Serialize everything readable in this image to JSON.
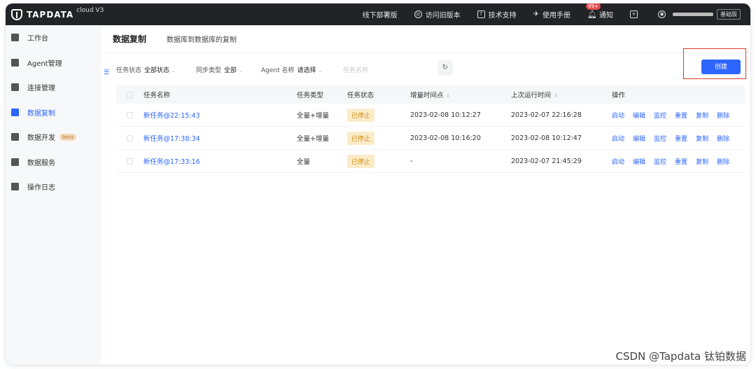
{
  "brand": {
    "logo_text": "TAPDATA",
    "logo_sub": "cloud V3"
  },
  "topbar": {
    "links": [
      {
        "icon": "",
        "label": "线下部署版"
      },
      {
        "icon": "globe-icon",
        "label": "访问旧版本"
      },
      {
        "icon": "help-icon",
        "label": "技术支持"
      },
      {
        "icon": "send-icon",
        "label": "使用手册"
      }
    ],
    "notification_badge": "99+",
    "notification_label": "通知",
    "edition": "基础版"
  },
  "sidebar": {
    "items": [
      {
        "icon": "dashboard-icon",
        "label": "工作台",
        "active": false
      },
      {
        "icon": "agent-icon",
        "label": "Agent管理",
        "active": false
      },
      {
        "icon": "connection-icon",
        "label": "连接管理",
        "active": false
      },
      {
        "icon": "replication-icon",
        "label": "数据复制",
        "active": true
      },
      {
        "icon": "dev-icon",
        "label": "数据开发",
        "badge": "beta",
        "active": false
      },
      {
        "icon": "service-icon",
        "label": "数据服务",
        "active": false
      },
      {
        "icon": "log-icon",
        "label": "操作日志",
        "active": false
      }
    ]
  },
  "page": {
    "title": "数据复制",
    "subtitle": "数据库到数据库的复制"
  },
  "filters": {
    "status": {
      "label": "任务状态",
      "value": "全部状态"
    },
    "sync_type": {
      "label": "同步类型",
      "value": "全部"
    },
    "agent": {
      "label": "Agent 名称",
      "value": "请选择"
    },
    "search_placeholder": "任务名称"
  },
  "create_label": "创建",
  "table": {
    "headers": {
      "name": "任务名称",
      "type": "任务类型",
      "status": "任务状态",
      "incremental": "增量时间点",
      "last_run": "上次运行时间",
      "ops": "操作"
    },
    "rows": [
      {
        "name": "新任务@22:15:43",
        "type": "全量+增量",
        "status": "已停止",
        "incremental": "2023-02-08 10:12:27",
        "last_run": "2023-02-07 22:16:28"
      },
      {
        "name": "新任务@17:38:34",
        "type": "全量+增量",
        "status": "已停止",
        "incremental": "2023-02-08 10:16:20",
        "last_run": "2023-02-08 10:12:47"
      },
      {
        "name": "新任务@17:33:16",
        "type": "全量",
        "status": "已停止",
        "incremental": "-",
        "last_run": "2023-02-07 21:45:29"
      }
    ],
    "ops": [
      "启动",
      "编辑",
      "监控",
      "重置",
      "复制",
      "删除"
    ]
  },
  "watermark": "CSDN @Tapdata 钛铂数据"
}
